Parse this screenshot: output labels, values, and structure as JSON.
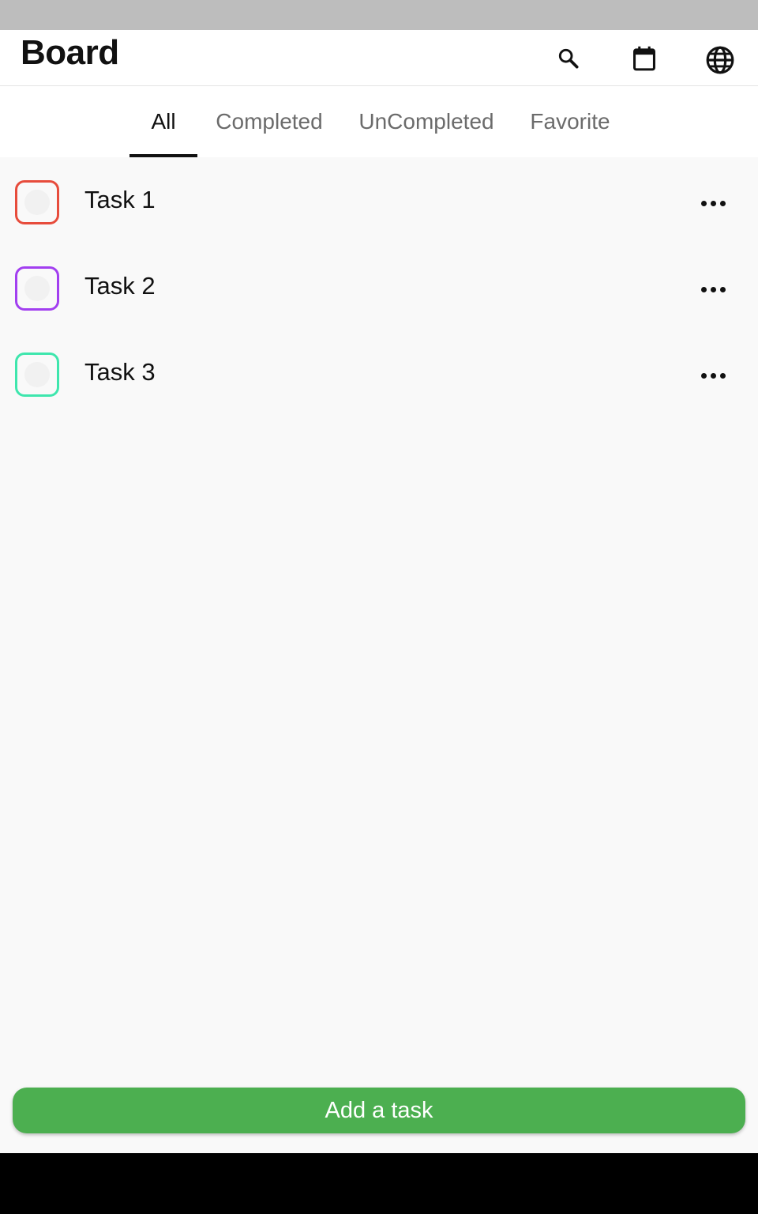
{
  "header": {
    "title": "Board",
    "icons": [
      "search-icon",
      "calendar-icon",
      "globe-icon"
    ]
  },
  "tabs": [
    {
      "label": "All",
      "active": true
    },
    {
      "label": "Completed",
      "active": false
    },
    {
      "label": "UnCompleted",
      "active": false
    },
    {
      "label": "Favorite",
      "active": false
    }
  ],
  "tasks": [
    {
      "label": "Task 1",
      "color": "#e74c3c",
      "completed": false,
      "menu_icon": "more-horizontal-icon"
    },
    {
      "label": "Task 2",
      "color": "#a23ff0",
      "completed": false,
      "menu_icon": "more-horizontal-icon"
    },
    {
      "label": "Task 3",
      "color": "#3ee6ad",
      "completed": false,
      "menu_icon": "more-horizontal-icon"
    }
  ],
  "footer": {
    "add_label": "Add a task",
    "add_color": "#4caf50"
  },
  "colors": {
    "status_bar": "#bdbdbd",
    "nav_bar": "#000000",
    "background": "#f9f9f9"
  }
}
